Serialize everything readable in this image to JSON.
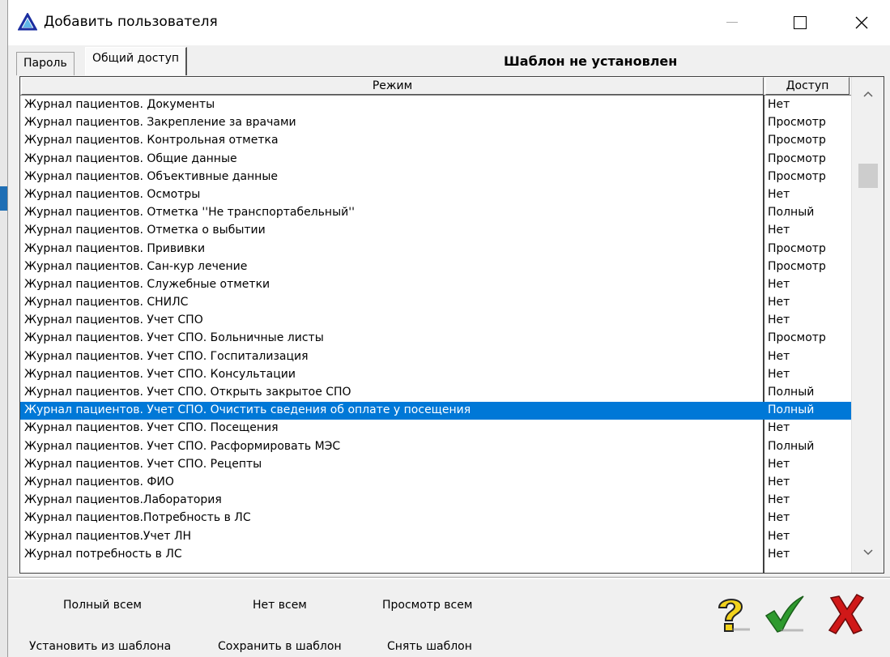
{
  "window": {
    "title": "Добавить пользователя",
    "icon": "delta-triangle-icon"
  },
  "tabs": [
    {
      "label": "Пароль",
      "active": false
    },
    {
      "label": "Общий доступ",
      "active": true
    }
  ],
  "template_status": "Шаблон не установлен",
  "grid": {
    "columns": [
      "Режим",
      "Доступ"
    ],
    "selected_index": 17,
    "rows": [
      {
        "mode": "Журнал пациентов. Документы",
        "access": "Нет"
      },
      {
        "mode": "Журнал пациентов. Закрепление за врачами",
        "access": "Просмотр"
      },
      {
        "mode": "Журнал пациентов. Контрольная отметка",
        "access": "Просмотр"
      },
      {
        "mode": "Журнал пациентов. Общие данные",
        "access": "Просмотр"
      },
      {
        "mode": "Журнал пациентов. Объективные данные",
        "access": "Просмотр"
      },
      {
        "mode": "Журнал пациентов. Осмотры",
        "access": "Нет"
      },
      {
        "mode": "Журнал пациентов. Отметка ''Не транспортабельный''",
        "access": "Полный"
      },
      {
        "mode": "Журнал пациентов. Отметка о выбытии",
        "access": "Нет"
      },
      {
        "mode": "Журнал пациентов. Прививки",
        "access": "Просмотр"
      },
      {
        "mode": "Журнал пациентов. Сан-кур лечение",
        "access": "Просмотр"
      },
      {
        "mode": "Журнал пациентов. Служебные отметки",
        "access": "Нет"
      },
      {
        "mode": "Журнал пациентов. СНИЛС",
        "access": "Нет"
      },
      {
        "mode": "Журнал пациентов. Учет СПО",
        "access": "Нет"
      },
      {
        "mode": "Журнал пациентов. Учет СПО. Больничные листы",
        "access": "Просмотр"
      },
      {
        "mode": "Журнал пациентов. Учет СПО. Госпитализация",
        "access": "Нет"
      },
      {
        "mode": "Журнал пациентов. Учет СПО. Консультации",
        "access": "Нет"
      },
      {
        "mode": "Журнал пациентов. Учет СПО. Открыть закрытое СПО",
        "access": "Полный"
      },
      {
        "mode": "Журнал пациентов. Учет СПО. Очистить сведения об оплате у посещения",
        "access": "Полный"
      },
      {
        "mode": "Журнал пациентов. Учет СПО. Посещения",
        "access": "Нет"
      },
      {
        "mode": "Журнал пациентов. Учет СПО. Расформировать МЭС",
        "access": "Полный"
      },
      {
        "mode": "Журнал пациентов. Учет СПО. Рецепты",
        "access": "Нет"
      },
      {
        "mode": "Журнал пациентов. ФИО",
        "access": "Нет"
      },
      {
        "mode": "Журнал пациентов.Лаборатория",
        "access": "Нет"
      },
      {
        "mode": "Журнал пациентов.Потребность в ЛС",
        "access": "Нет"
      },
      {
        "mode": "Журнал пациентов.Учет ЛН",
        "access": "Нет"
      },
      {
        "mode": "Журнал потребность в ЛС",
        "access": "Нет"
      }
    ]
  },
  "actions": {
    "full_all": "Полный всем",
    "none_all": "Нет всем",
    "view_all": "Просмотр всем",
    "set_from_template": "Установить из шаблона",
    "save_to_template": "Сохранить в шаблон",
    "remove_template": "Снять шаблон"
  },
  "icons": {
    "help": "question-mark-icon",
    "ok": "checkmark-icon",
    "cancel": "red-x-icon"
  },
  "colors": {
    "selection": "#0078d7",
    "ok": "#2e9a2e",
    "cancel": "#d01818",
    "help": "#f2d21b"
  }
}
